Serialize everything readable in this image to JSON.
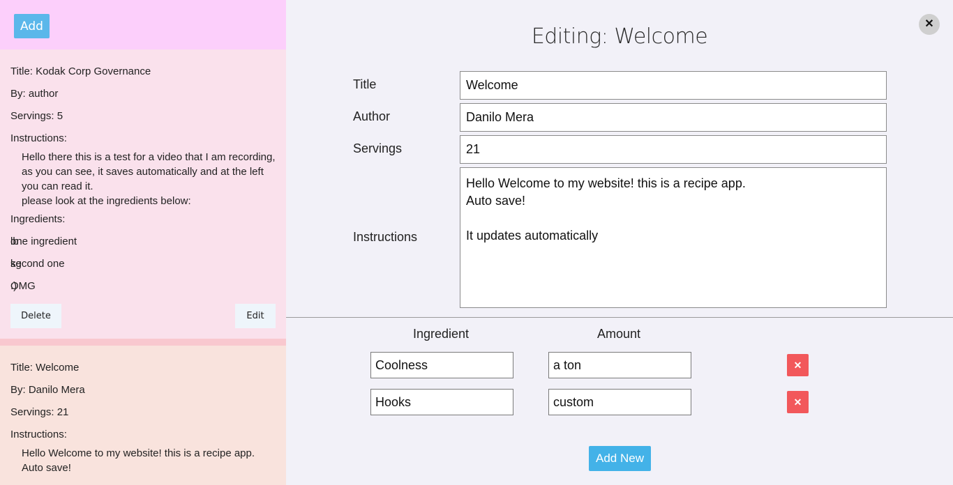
{
  "sidebar": {
    "add_label": "Add",
    "cards": [
      {
        "title": "Title: Kodak Corp Governance",
        "by": "By: author",
        "servings": "Servings: 5",
        "instructions_label": "Instructions:",
        "instructions": "Hello there this is a test for a video that I am recording, as you can see, it saves automatically and at the left you can read it.\nplease look at the ingredients below:",
        "ingredients_label": "Ingredients:",
        "ingredients": [
          {
            "name": "one ingredient",
            "amount": "lb"
          },
          {
            "name": "second one",
            "amount": "kg"
          },
          {
            "name": "OMG",
            "amount": ":)"
          }
        ],
        "delete_label": "Delete",
        "edit_label": "Edit"
      },
      {
        "title": "Title: Welcome",
        "by": "By: Danilo Mera",
        "servings": "Servings: 21",
        "instructions_label": "Instructions:",
        "instructions": "Hello Welcome to my website! this is a recipe app.\nAuto save!"
      }
    ]
  },
  "editor": {
    "heading": "Editing: Welcome",
    "close_label": "✕",
    "fields": {
      "title_label": "Title",
      "title_value": "Welcome",
      "author_label": "Author",
      "author_value": "Danilo Mera",
      "servings_label": "Servings",
      "servings_value": "21",
      "instructions_label": "Instructions",
      "instructions_value": "Hello Welcome to my website! this is a recipe app.\nAuto save!\n\nIt updates automatically"
    },
    "ingredient_header": "Ingredient",
    "amount_header": "Amount",
    "ingredients": [
      {
        "name": "Coolness",
        "amount": "a ton"
      },
      {
        "name": "Hooks",
        "amount": "custom"
      }
    ],
    "delete_symbol": "✕",
    "add_new_label": "Add New"
  },
  "colors": {
    "add_button": "#5bb7ea",
    "delete_button": "#f2585b",
    "sidebar_header": "#fccffb"
  }
}
